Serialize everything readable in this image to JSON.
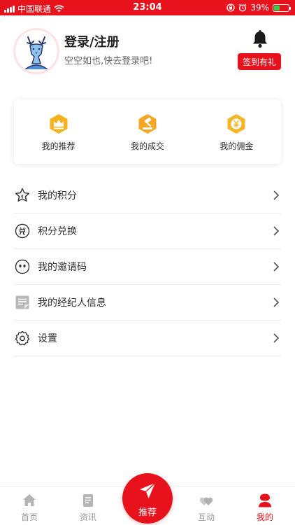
{
  "status_bar": {
    "carrier": "中国联通",
    "time": "23:04",
    "battery": "39%",
    "battery_level": 0.39,
    "icons": [
      "signal-icon",
      "wifi-icon",
      "orientation-lock-icon",
      "alarm-icon",
      "battery-icon"
    ]
  },
  "profile": {
    "title": "登录/注册",
    "subtitle": "空空如也,快去登录吧!",
    "avatar_icon": "deer-avatar-icon",
    "bell_icon": "bell-icon",
    "signin_label": "签到有礼"
  },
  "quick_actions": [
    {
      "label": "我的推荐",
      "icon": "crown-icon"
    },
    {
      "label": "我的成交",
      "icon": "gavel-icon"
    },
    {
      "label": "我的佣金",
      "icon": "yen-icon"
    }
  ],
  "menu": [
    {
      "label": "我的积分",
      "icon": "star-icon"
    },
    {
      "label": "积分兑换",
      "icon": "exchange-icon"
    },
    {
      "label": "我的邀请码",
      "icon": "invite-code-icon"
    },
    {
      "label": "我的经纪人信息",
      "icon": "document-icon"
    },
    {
      "label": "设置",
      "icon": "settings-icon"
    }
  ],
  "tabbar": {
    "home": "首页",
    "news": "资讯",
    "recommend": "推荐",
    "interact": "互动",
    "mine": "我的",
    "active": "mine"
  },
  "colors": {
    "brand_red": "#e8121c",
    "gold": "#f5b21b",
    "tab_inactive": "#9a9a9a"
  }
}
